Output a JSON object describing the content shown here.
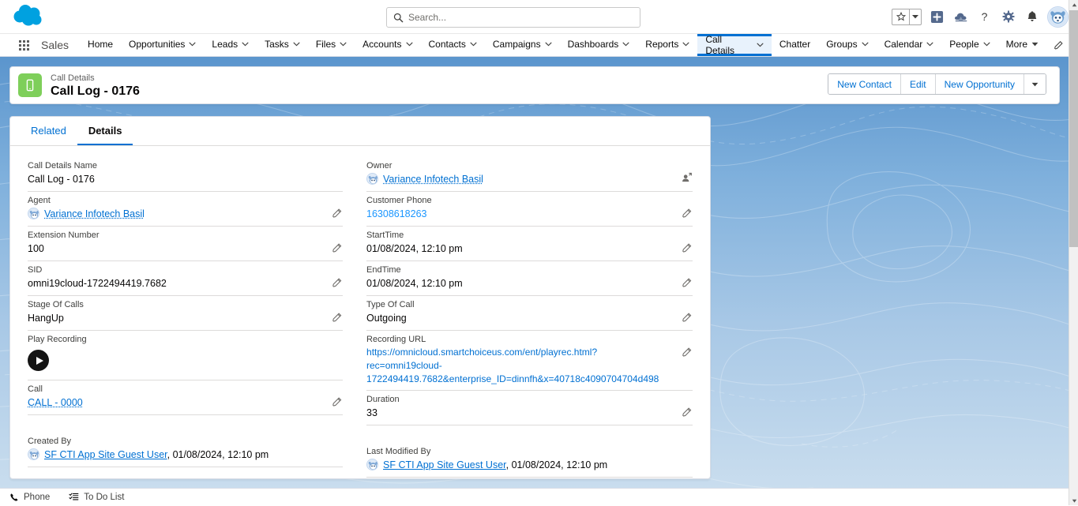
{
  "header": {
    "logo_icon": "salesforce-cloud-logo",
    "search": {
      "placeholder": "Search...",
      "value": "",
      "icon": "search-icon"
    },
    "icons": [
      {
        "name": "favorites-star-icon",
        "glyph": "star"
      },
      {
        "name": "favorites-dropdown-icon",
        "glyph": "caret-down"
      },
      {
        "name": "global-actions-icon",
        "glyph": "plus-box"
      },
      {
        "name": "service-setup-icon",
        "glyph": "cloud-setup"
      },
      {
        "name": "help-icon",
        "glyph": "question-mark"
      },
      {
        "name": "setup-gear-icon",
        "glyph": "gear"
      },
      {
        "name": "notifications-bell-icon",
        "glyph": "bell"
      },
      {
        "name": "user-avatar",
        "glyph": "avatar"
      }
    ]
  },
  "nav": {
    "app_launcher_icon": "app-launcher-icon",
    "app_name": "Sales",
    "items": [
      {
        "label": "Home",
        "has_caret": false,
        "active": false
      },
      {
        "label": "Opportunities",
        "has_caret": true,
        "active": false
      },
      {
        "label": "Leads",
        "has_caret": true,
        "active": false
      },
      {
        "label": "Tasks",
        "has_caret": true,
        "active": false
      },
      {
        "label": "Files",
        "has_caret": true,
        "active": false
      },
      {
        "label": "Accounts",
        "has_caret": true,
        "active": false
      },
      {
        "label": "Contacts",
        "has_caret": true,
        "active": false
      },
      {
        "label": "Campaigns",
        "has_caret": true,
        "active": false
      },
      {
        "label": "Dashboards",
        "has_caret": true,
        "active": false
      },
      {
        "label": "Reports",
        "has_caret": true,
        "active": false
      },
      {
        "label": "Call Details",
        "has_caret": true,
        "active": true
      },
      {
        "label": "Chatter",
        "has_caret": false,
        "active": false
      },
      {
        "label": "Groups",
        "has_caret": true,
        "active": false
      },
      {
        "label": "Calendar",
        "has_caret": true,
        "active": false
      },
      {
        "label": "People",
        "has_caret": true,
        "active": false
      },
      {
        "label": "More",
        "has_caret": true,
        "active": false
      }
    ],
    "edit_pencil_icon": "pencil-icon"
  },
  "record_header": {
    "icon": "mobile-phone-icon",
    "icon_color": "#7ecf5a",
    "object_label": "Call Details",
    "record_title": "Call Log - 0176",
    "actions": [
      {
        "label": "New Contact"
      },
      {
        "label": "Edit"
      },
      {
        "label": "New Opportunity"
      }
    ],
    "actions_more_icon": "caret-down-icon"
  },
  "detail": {
    "tabs": [
      {
        "label": "Related",
        "active": false
      },
      {
        "label": "Details",
        "active": true
      }
    ],
    "left_fields": [
      {
        "label": "Call Details Name",
        "value": "Call Log - 0176",
        "type": "text",
        "editable": false
      },
      {
        "label": "Agent",
        "value": "Variance Infotech Basil",
        "type": "user-link",
        "editable": true
      },
      {
        "label": "Extension Number",
        "value": "100",
        "type": "text",
        "editable": true
      },
      {
        "label": "SID",
        "value": "omni19cloud-1722494419.7682",
        "type": "text",
        "editable": true
      },
      {
        "label": "Stage Of Calls",
        "value": "HangUp",
        "type": "text",
        "editable": true
      },
      {
        "label": "Play Recording",
        "value": "",
        "type": "play-button",
        "editable": false
      },
      {
        "label": "Call",
        "value": "CALL - 0000",
        "type": "link",
        "editable": true
      }
    ],
    "right_fields": [
      {
        "label": "Owner",
        "value": "Variance Infotech Basil",
        "type": "user-link",
        "editable": false,
        "owner_action": true
      },
      {
        "label": "Customer Phone",
        "value": "16308618263",
        "type": "phone",
        "editable": true
      },
      {
        "label": "StartTime",
        "value": "01/08/2024, 12:10 pm",
        "type": "text",
        "editable": true
      },
      {
        "label": "EndTime",
        "value": "01/08/2024, 12:10 pm",
        "type": "text",
        "editable": true
      },
      {
        "label": "Type Of Call",
        "value": "Outgoing",
        "type": "text",
        "editable": true
      },
      {
        "label": "Recording URL",
        "value": "https://omnicloud.smartchoiceus.com/ent/playrec.html?rec=omni19cloud-1722494419.7682&enterprise_ID=dinnfh&x=40718c4090704704d498",
        "type": "url",
        "editable": true
      },
      {
        "label": "Duration",
        "value": "33",
        "type": "text",
        "editable": true
      }
    ],
    "created_by": {
      "label": "Created By",
      "user": "SF CTI App Site Guest User",
      "timestamp": ", 01/08/2024, 12:10 pm"
    },
    "last_modified_by": {
      "label": "Last Modified By",
      "user": "SF CTI App Site Guest User",
      "timestamp": ", 01/08/2024, 12:10 pm"
    }
  },
  "utility_bar": {
    "items": [
      {
        "label": "Phone",
        "icon": "phone-icon"
      },
      {
        "label": "To Do List",
        "icon": "todo-list-icon"
      }
    ]
  },
  "colors": {
    "brand_blue": "#0070d2",
    "link_blue": "#1b96ff",
    "record_icon_green": "#7ecf5a",
    "bg_blue_top": "#5b95cd",
    "bg_blue_bottom": "#c9ddee"
  }
}
